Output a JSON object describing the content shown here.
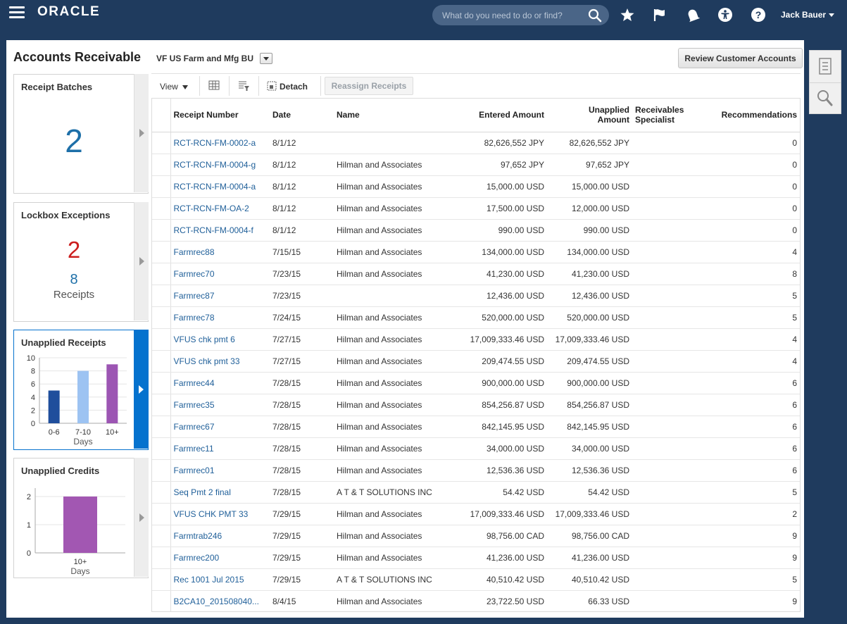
{
  "header": {
    "logo_text": "ORACLE",
    "search_placeholder": "What do you need to do or find?",
    "user_name": "Jack Bauer",
    "icons": [
      "hamburger-icon",
      "search-icon",
      "star-icon",
      "flag-icon",
      "bell-icon",
      "accessibility-icon",
      "help-icon"
    ]
  },
  "page": {
    "title": "Accounts Receivable",
    "business_unit": "VF US Farm and Mfg BU",
    "review_button": "Review Customer Accounts"
  },
  "tiles": {
    "receipt_batches": {
      "title": "Receipt Batches",
      "count": "2"
    },
    "lockbox_exceptions": {
      "title": "Lockbox Exceptions",
      "count": "2",
      "receipts_count": "8",
      "receipts_label": "Receipts"
    },
    "unapplied_receipts": {
      "title": "Unapplied Receipts",
      "chart_data": {
        "type": "bar",
        "categories": [
          "0-6",
          "7-10",
          "10+"
        ],
        "values": [
          5,
          8,
          9
        ],
        "colors": [
          "#1f4e9c",
          "#9dc3f2",
          "#9c55b3"
        ],
        "xlabel": "Days",
        "ylim": [
          0,
          10
        ],
        "yticks": [
          "0",
          "2",
          "4",
          "6",
          "8",
          "10"
        ]
      }
    },
    "unapplied_credits": {
      "title": "Unapplied Credits",
      "chart_data": {
        "type": "bar",
        "categories": [
          "10+"
        ],
        "values": [
          2
        ],
        "colors": [
          "#a257b2"
        ],
        "xlabel": "Days",
        "ylim": [
          0,
          2.3
        ],
        "yticks": [
          "0",
          "1",
          "2"
        ]
      }
    }
  },
  "toolbar": {
    "view_label": "View",
    "detach_label": "Detach",
    "reassign_label": "Reassign Receipts"
  },
  "table": {
    "columns": {
      "receipt_number": "Receipt Number",
      "date": "Date",
      "name": "Name",
      "entered_amount": "Entered Amount",
      "unapplied_line1": "Unapplied",
      "unapplied_line2": "Amount",
      "specialist_line1": "Receivables",
      "specialist_line2": "Specialist",
      "recommendations": "Recommendations"
    },
    "rows": [
      {
        "receipt": "RCT-RCN-FM-0002-a",
        "date": "8/1/12",
        "name": "",
        "entered": "82,626,552 JPY",
        "unapplied": "82,626,552 JPY",
        "specialist": "",
        "recs": "0"
      },
      {
        "receipt": "RCT-RCN-FM-0004-g",
        "date": "8/1/12",
        "name": "Hilman and Associates",
        "entered": "97,652 JPY",
        "unapplied": "97,652 JPY",
        "specialist": "",
        "recs": "0"
      },
      {
        "receipt": "RCT-RCN-FM-0004-a",
        "date": "8/1/12",
        "name": "Hilman and Associates",
        "entered": "15,000.00 USD",
        "unapplied": "15,000.00 USD",
        "specialist": "",
        "recs": "0"
      },
      {
        "receipt": "RCT-RCN-FM-OA-2",
        "date": "8/1/12",
        "name": "Hilman and Associates",
        "entered": "17,500.00 USD",
        "unapplied": "12,000.00 USD",
        "specialist": "",
        "recs": "0"
      },
      {
        "receipt": "RCT-RCN-FM-0004-f",
        "date": "8/1/12",
        "name": "Hilman and Associates",
        "entered": "990.00 USD",
        "unapplied": "990.00 USD",
        "specialist": "",
        "recs": "0"
      },
      {
        "receipt": "Farmrec88",
        "date": "7/15/15",
        "name": "Hilman and Associates",
        "entered": "134,000.00 USD",
        "unapplied": "134,000.00 USD",
        "specialist": "",
        "recs": "4"
      },
      {
        "receipt": "Farmrec70",
        "date": "7/23/15",
        "name": "Hilman and Associates",
        "entered": "41,230.00 USD",
        "unapplied": "41,230.00 USD",
        "specialist": "",
        "recs": "8"
      },
      {
        "receipt": "Farmrec87",
        "date": "7/23/15",
        "name": "",
        "entered": "12,436.00 USD",
        "unapplied": "12,436.00 USD",
        "specialist": "",
        "recs": "5"
      },
      {
        "receipt": "Farmrec78",
        "date": "7/24/15",
        "name": "Hilman and Associates",
        "entered": "520,000.00 USD",
        "unapplied": "520,000.00 USD",
        "specialist": "",
        "recs": "5"
      },
      {
        "receipt": "VFUS chk pmt 6",
        "date": "7/27/15",
        "name": "Hilman and Associates",
        "entered": "17,009,333.46 USD",
        "unapplied": "17,009,333.46 USD",
        "specialist": "",
        "recs": "4"
      },
      {
        "receipt": "VFUS chk pmt 33",
        "date": "7/27/15",
        "name": "Hilman and Associates",
        "entered": "209,474.55 USD",
        "unapplied": "209,474.55 USD",
        "specialist": "",
        "recs": "4"
      },
      {
        "receipt": "Farmrec44",
        "date": "7/28/15",
        "name": "Hilman and Associates",
        "entered": "900,000.00 USD",
        "unapplied": "900,000.00 USD",
        "specialist": "",
        "recs": "6"
      },
      {
        "receipt": "Farmrec35",
        "date": "7/28/15",
        "name": "Hilman and Associates",
        "entered": "854,256.87 USD",
        "unapplied": "854,256.87 USD",
        "specialist": "",
        "recs": "6"
      },
      {
        "receipt": "Farmrec67",
        "date": "7/28/15",
        "name": "Hilman and Associates",
        "entered": "842,145.95 USD",
        "unapplied": "842,145.95 USD",
        "specialist": "",
        "recs": "6"
      },
      {
        "receipt": "Farmrec11",
        "date": "7/28/15",
        "name": "Hilman and Associates",
        "entered": "34,000.00 USD",
        "unapplied": "34,000.00 USD",
        "specialist": "",
        "recs": "6"
      },
      {
        "receipt": "Farmrec01",
        "date": "7/28/15",
        "name": "Hilman and Associates",
        "entered": "12,536.36 USD",
        "unapplied": "12,536.36 USD",
        "specialist": "",
        "recs": "6"
      },
      {
        "receipt": "Seq Pmt 2 final",
        "date": "7/28/15",
        "name": "A T & T SOLUTIONS INC",
        "entered": "54.42 USD",
        "unapplied": "54.42 USD",
        "specialist": "",
        "recs": "5"
      },
      {
        "receipt": "VFUS CHK PMT 33",
        "date": "7/29/15",
        "name": "Hilman and Associates",
        "entered": "17,009,333.46 USD",
        "unapplied": "17,009,333.46 USD",
        "specialist": "",
        "recs": "2"
      },
      {
        "receipt": "Farmtrab246",
        "date": "7/29/15",
        "name": "Hilman and Associates",
        "entered": "98,756.00 CAD",
        "unapplied": "98,756.00 CAD",
        "specialist": "",
        "recs": "9"
      },
      {
        "receipt": "Farmrec200",
        "date": "7/29/15",
        "name": "Hilman and Associates",
        "entered": "41,236.00 USD",
        "unapplied": "41,236.00 USD",
        "specialist": "",
        "recs": "9"
      },
      {
        "receipt": "Rec 1001 Jul 2015",
        "date": "7/29/15",
        "name": "A T & T SOLUTIONS INC",
        "entered": "40,510.42 USD",
        "unapplied": "40,510.42 USD",
        "specialist": "",
        "recs": "5"
      },
      {
        "receipt": "B2CA10_201508040...",
        "date": "8/4/15",
        "name": "Hilman and Associates",
        "entered": "23,722.50 USD",
        "unapplied": "66.33 USD",
        "specialist": "",
        "recs": "9"
      }
    ]
  },
  "colors": {
    "header_bg": "#1f3b5e",
    "link": "#1f5f99",
    "accent_blue": "#0572ce",
    "count_blue": "#1d6fa8",
    "count_red": "#cc1f1f"
  }
}
